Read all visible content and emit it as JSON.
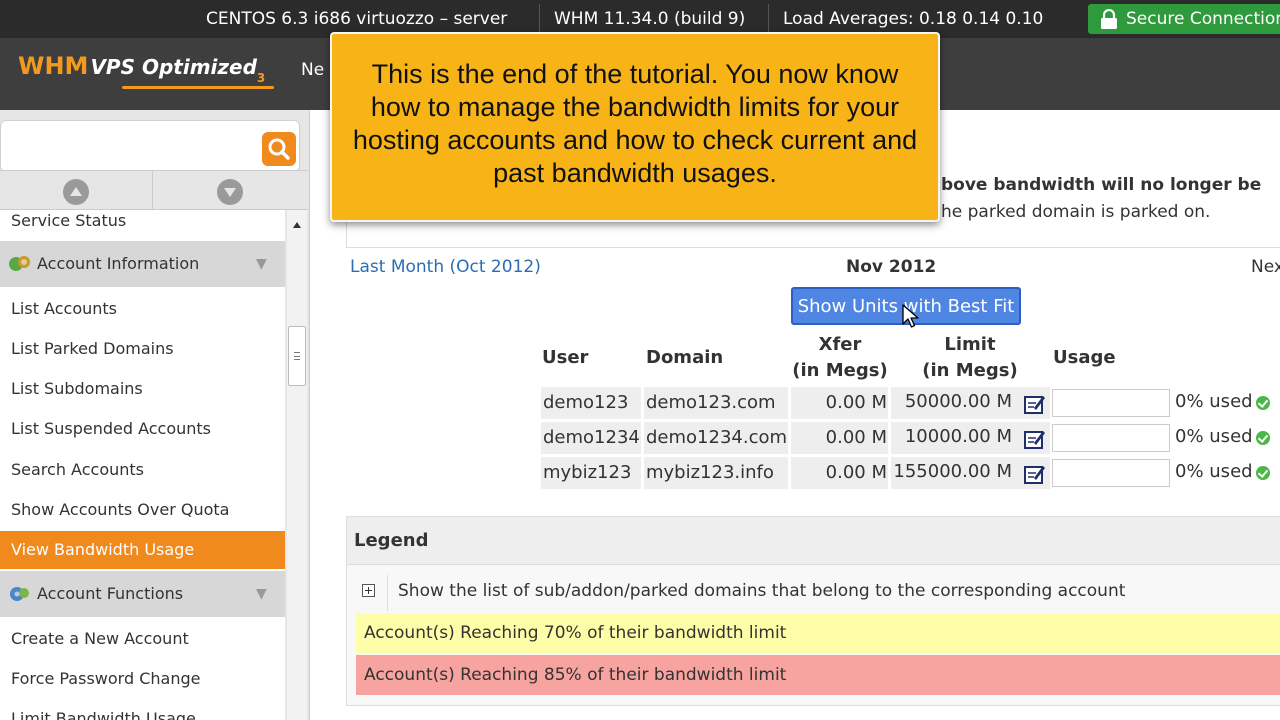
{
  "topbar": {
    "server": "CENTOS 6.3 i686 virtuozzo – server",
    "version": "WHM 11.34.0 (build 9)",
    "load": "Load Averages: 0.18 0.14 0.10",
    "secure": "Secure Connection"
  },
  "header": {
    "logo_main": "WHM",
    "logo_sub": "VPS Optimized",
    "logo_num": "3",
    "nav_partial": "Ne"
  },
  "search": {
    "value": ""
  },
  "sidebar": {
    "items": [
      {
        "label": "Service Status"
      },
      {
        "label": "Account Information",
        "group": true
      },
      {
        "label": "List Accounts"
      },
      {
        "label": "List Parked Domains"
      },
      {
        "label": "List Subdomains"
      },
      {
        "label": "List Suspended Accounts"
      },
      {
        "label": "Search Accounts"
      },
      {
        "label": "Show Accounts Over Quota"
      },
      {
        "label": "View Bandwidth Usage",
        "active": true
      },
      {
        "label": "Account Functions",
        "group": true
      },
      {
        "label": "Create a New Account"
      },
      {
        "label": "Force Password Change"
      },
      {
        "label": "Limit Bandwidth Usage"
      }
    ]
  },
  "notice": {
    "line1": "bove bandwidth will no longer be",
    "line2": "he parked domain is parked on."
  },
  "nav": {
    "prev": "Last Month (Oct 2012)",
    "current": "Nov 2012",
    "next": "Nex"
  },
  "units_button": "Show Units with Best Fit",
  "table": {
    "headers": {
      "user": "User",
      "domain": "Domain",
      "xfer1": "Xfer",
      "xfer2": "(in Megs)",
      "limit1": "Limit",
      "limit2": "(in Megs)",
      "usage": "Usage"
    },
    "rows": [
      {
        "user": "demo123",
        "domain": "demo123.com",
        "xfer": "0.00 M",
        "limit": "50000.00 M",
        "usage_pct": 0,
        "used": "0% used"
      },
      {
        "user": "demo1234",
        "domain": "demo1234.com",
        "xfer": "0.00 M",
        "limit": "10000.00 M",
        "usage_pct": 0,
        "used": "0% used"
      },
      {
        "user": "mybiz123",
        "domain": "mybiz123.info",
        "xfer": "0.00 M",
        "limit": "155000.00 M",
        "usage_pct": 0,
        "used": "0% used"
      }
    ]
  },
  "legend": {
    "title": "Legend",
    "expand_desc": "Show the list of sub/addon/parked domains that belong to the corresponding account",
    "yellow": "Account(s) Reaching 70% of their bandwidth limit",
    "red": "Account(s) Reaching 85% of their bandwidth limit"
  },
  "callout": {
    "text": "This is the end of the tutorial. You now know how to manage the bandwidth limits for your hosting accounts and how to check current and past bandwidth usages."
  },
  "colors": {
    "accent": "#f18a1c",
    "callout": "#f8b417",
    "button": "#4f86e3",
    "legend_yellow": "#fefea8",
    "legend_red": "#f7a3a0",
    "ok": "#4cb648"
  }
}
